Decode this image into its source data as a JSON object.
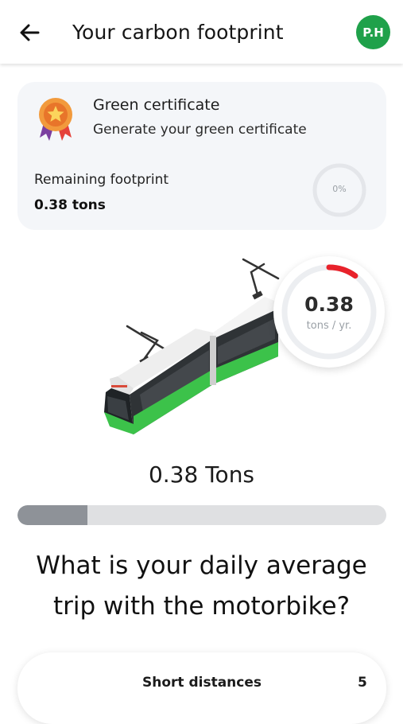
{
  "header": {
    "title": "Your carbon footprint",
    "avatar_initials": "P.H",
    "avatar_color": "#1fa14a"
  },
  "certificate": {
    "title": "Green certificate",
    "subtitle": "Generate your green certificate",
    "remaining_label": "Remaining footprint",
    "remaining_value": "0.38 tons",
    "percent": "0%"
  },
  "gauge": {
    "value": "0.38",
    "unit": "tons / yr.",
    "fraction": 0.1,
    "accent": "#e8222b"
  },
  "summary": {
    "tons": "0.38 Tons",
    "progress_fraction": 0.19
  },
  "question": "What is your daily average trip with the motorbike?",
  "option": {
    "label": "Short distances",
    "value": "5"
  },
  "icons": {
    "back": "arrow-left-icon",
    "medal": "medal-icon",
    "vehicle": "tram-illustration"
  }
}
